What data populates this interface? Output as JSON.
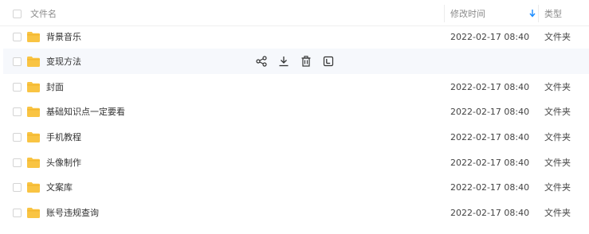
{
  "header": {
    "name_label": "文件名",
    "time_label": "修改时间",
    "type_label": "类型"
  },
  "rows": [
    {
      "name": "背景音乐",
      "time": "2022-02-17 08:40",
      "type": "文件夹"
    },
    {
      "name": "变现方法",
      "time": "",
      "type": ""
    },
    {
      "name": "封面",
      "time": "2022-02-17 08:40",
      "type": "文件夹"
    },
    {
      "name": "基础知识点一定要看",
      "time": "2022-02-17 08:40",
      "type": "文件夹"
    },
    {
      "name": "手机教程",
      "time": "2022-02-17 08:40",
      "type": "文件夹"
    },
    {
      "name": "头像制作",
      "time": "2022-02-17 08:40",
      "type": "文件夹"
    },
    {
      "name": "文案库",
      "time": "2022-02-17 08:40",
      "type": "文件夹"
    },
    {
      "name": "账号违规查询",
      "time": "2022-02-17 08:40",
      "type": "文件夹"
    }
  ],
  "hover_actions": [
    "share-icon",
    "download-icon",
    "delete-icon",
    "more-icon"
  ],
  "colors": {
    "folder": "#f9c443",
    "folder_dark": "#f2b52c",
    "sort_arrow": "#1a8cff",
    "icon": "#333333",
    "hover_bg": "#f6f8fc"
  }
}
